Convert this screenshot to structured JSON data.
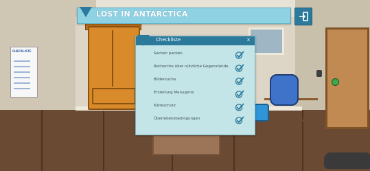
{
  "game": {
    "title": "LOST IN ANTARCTICA",
    "exit_icon": "exit-door-icon"
  },
  "poster": {
    "title": "CHECKLISTE"
  },
  "checklist": {
    "title": "Checkliste",
    "close_label": "×",
    "items": [
      {
        "label": "Sachen packen",
        "checked": true
      },
      {
        "label": "Recherche über nützliche Gegenstände",
        "checked": true
      },
      {
        "label": "Bildersuche",
        "checked": true
      },
      {
        "label": "Erstellung Menugerie",
        "checked": true
      },
      {
        "label": "Kälteschutz",
        "checked": true
      },
      {
        "label": "Überlebensbedingungen",
        "checked": true
      }
    ]
  },
  "colors": {
    "accent": "#2b7a9c",
    "panel_bg": "#c3e5e8",
    "titlebar_bg": "#8fd2e3",
    "check": "#2b7a9c"
  }
}
